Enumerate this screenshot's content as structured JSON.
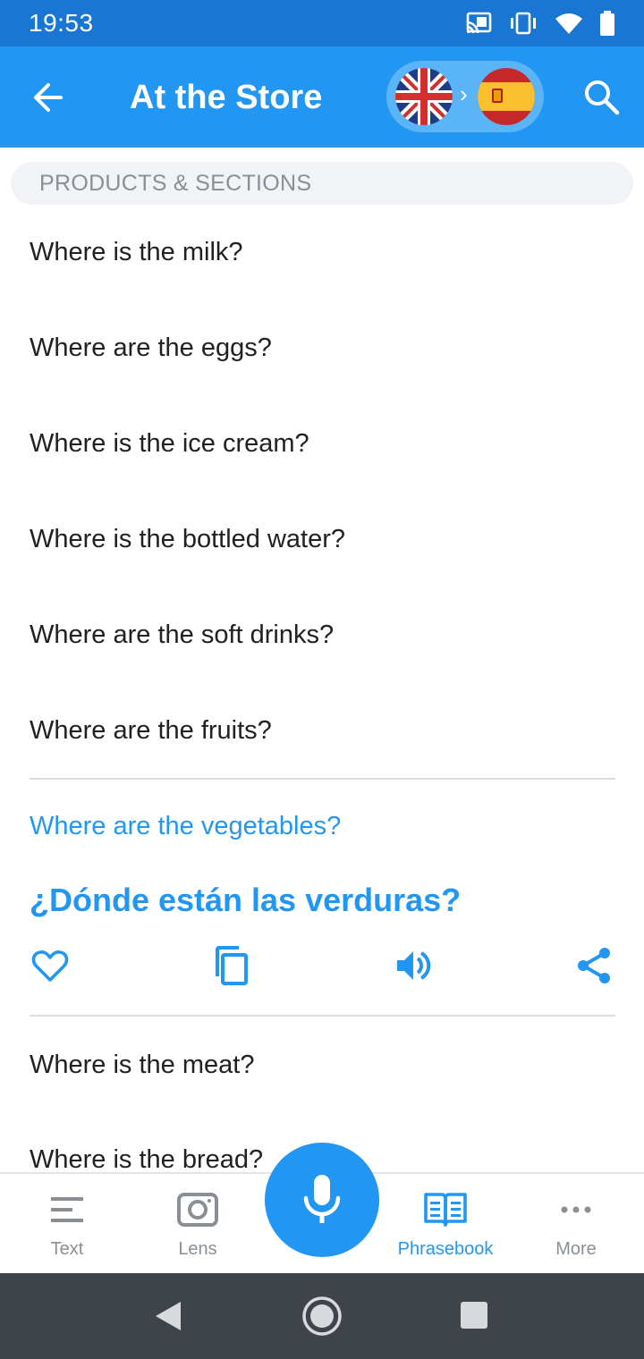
{
  "status_bar": {
    "time": "19:53",
    "icons": [
      "cast-icon",
      "vibrate-icon",
      "wifi-icon",
      "battery-icon"
    ]
  },
  "app_bar": {
    "title": "At the Store",
    "source_language_flag": "uk-flag-icon",
    "target_language_flag": "spain-flag-icon",
    "arrow": "›"
  },
  "section": {
    "header": "PRODUCTS & SECTIONS"
  },
  "phrases": [
    "Where is the milk?",
    "Where are the eggs?",
    "Where is the ice cream?",
    "Where is the bottled water?",
    "Where are the soft drinks?",
    "Where are the fruits?",
    "Where are the vegetables?",
    "Where is the meat?",
    "Where is the bread?"
  ],
  "expanded": {
    "translation": "¿Dónde están las verduras?",
    "actions": [
      "heart-icon",
      "copy-icon",
      "speaker-icon",
      "share-icon"
    ]
  },
  "bottom_nav": {
    "items": [
      {
        "label": "Text",
        "icon": "text-icon"
      },
      {
        "label": "Lens",
        "icon": "camera-icon"
      },
      {
        "label": "Phrasebook",
        "icon": "phrasebook-icon",
        "active": true
      },
      {
        "label": "More",
        "icon": "more-icon"
      }
    ],
    "mic": "mic-icon"
  },
  "colors": {
    "status_bar": "#1976d2",
    "app_bar": "#2196f3",
    "accent": "#2196f3",
    "text": "#212121",
    "muted": "#8a8f96",
    "system_nav": "#3f444a"
  }
}
